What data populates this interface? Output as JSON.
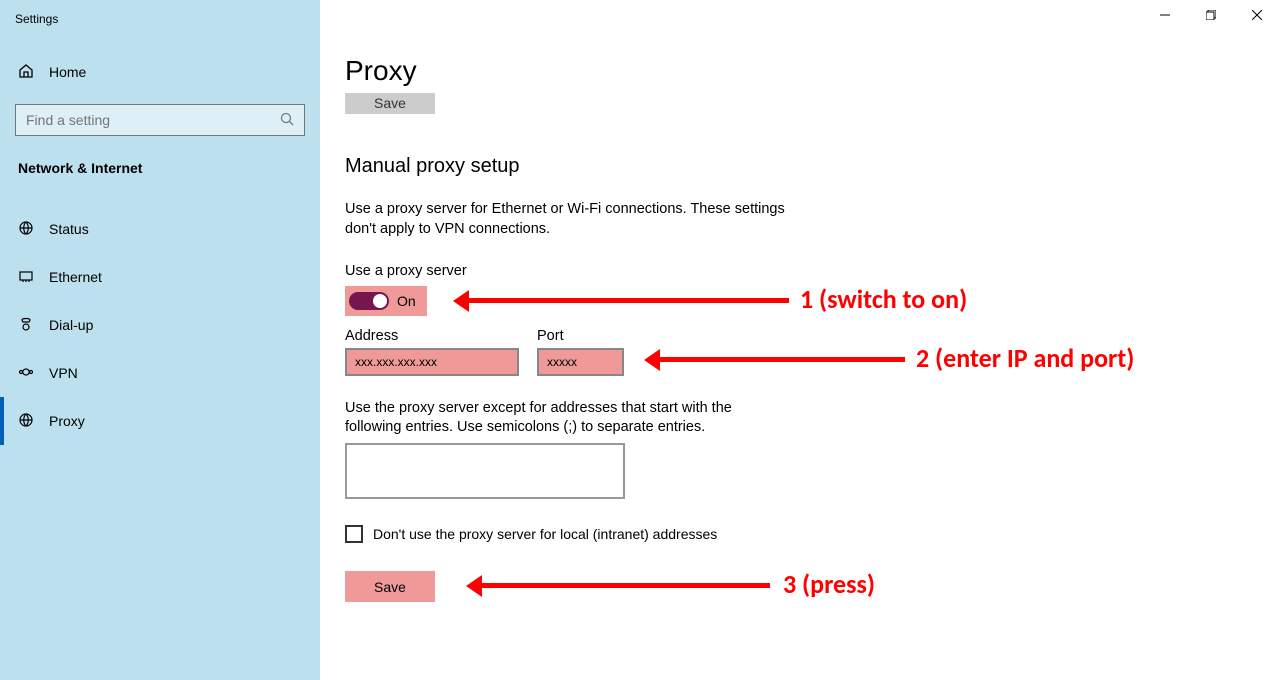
{
  "window": {
    "title": "Settings"
  },
  "sidebar": {
    "home": "Home",
    "search_placeholder": "Find a setting",
    "category": "Network & Internet",
    "items": [
      {
        "label": "Status",
        "icon": "status"
      },
      {
        "label": "Ethernet",
        "icon": "ethernet"
      },
      {
        "label": "Dial-up",
        "icon": "dialup"
      },
      {
        "label": "VPN",
        "icon": "vpn"
      },
      {
        "label": "Proxy",
        "icon": "proxy",
        "active": true
      }
    ]
  },
  "page": {
    "title": "Proxy",
    "ghost_save": "Save",
    "section_heading": "Manual proxy setup",
    "section_desc": "Use a proxy server for Ethernet or Wi-Fi connections. These settings don't apply to VPN connections.",
    "use_proxy_label": "Use a proxy server",
    "toggle_state": "On",
    "address_label": "Address",
    "address_value": "xxx.xxx.xxx.xxx",
    "port_label": "Port",
    "port_value": "xxxxx",
    "except_desc": "Use the proxy server except for addresses that start with the following entries. Use semicolons (;) to separate entries.",
    "local_checkbox_label": "Don't use the proxy server for local (intranet) addresses",
    "save_label": "Save"
  },
  "annotations": {
    "a1": "1 (switch to on)",
    "a2": "2 (enter IP and port)",
    "a3": "3 (press)"
  }
}
